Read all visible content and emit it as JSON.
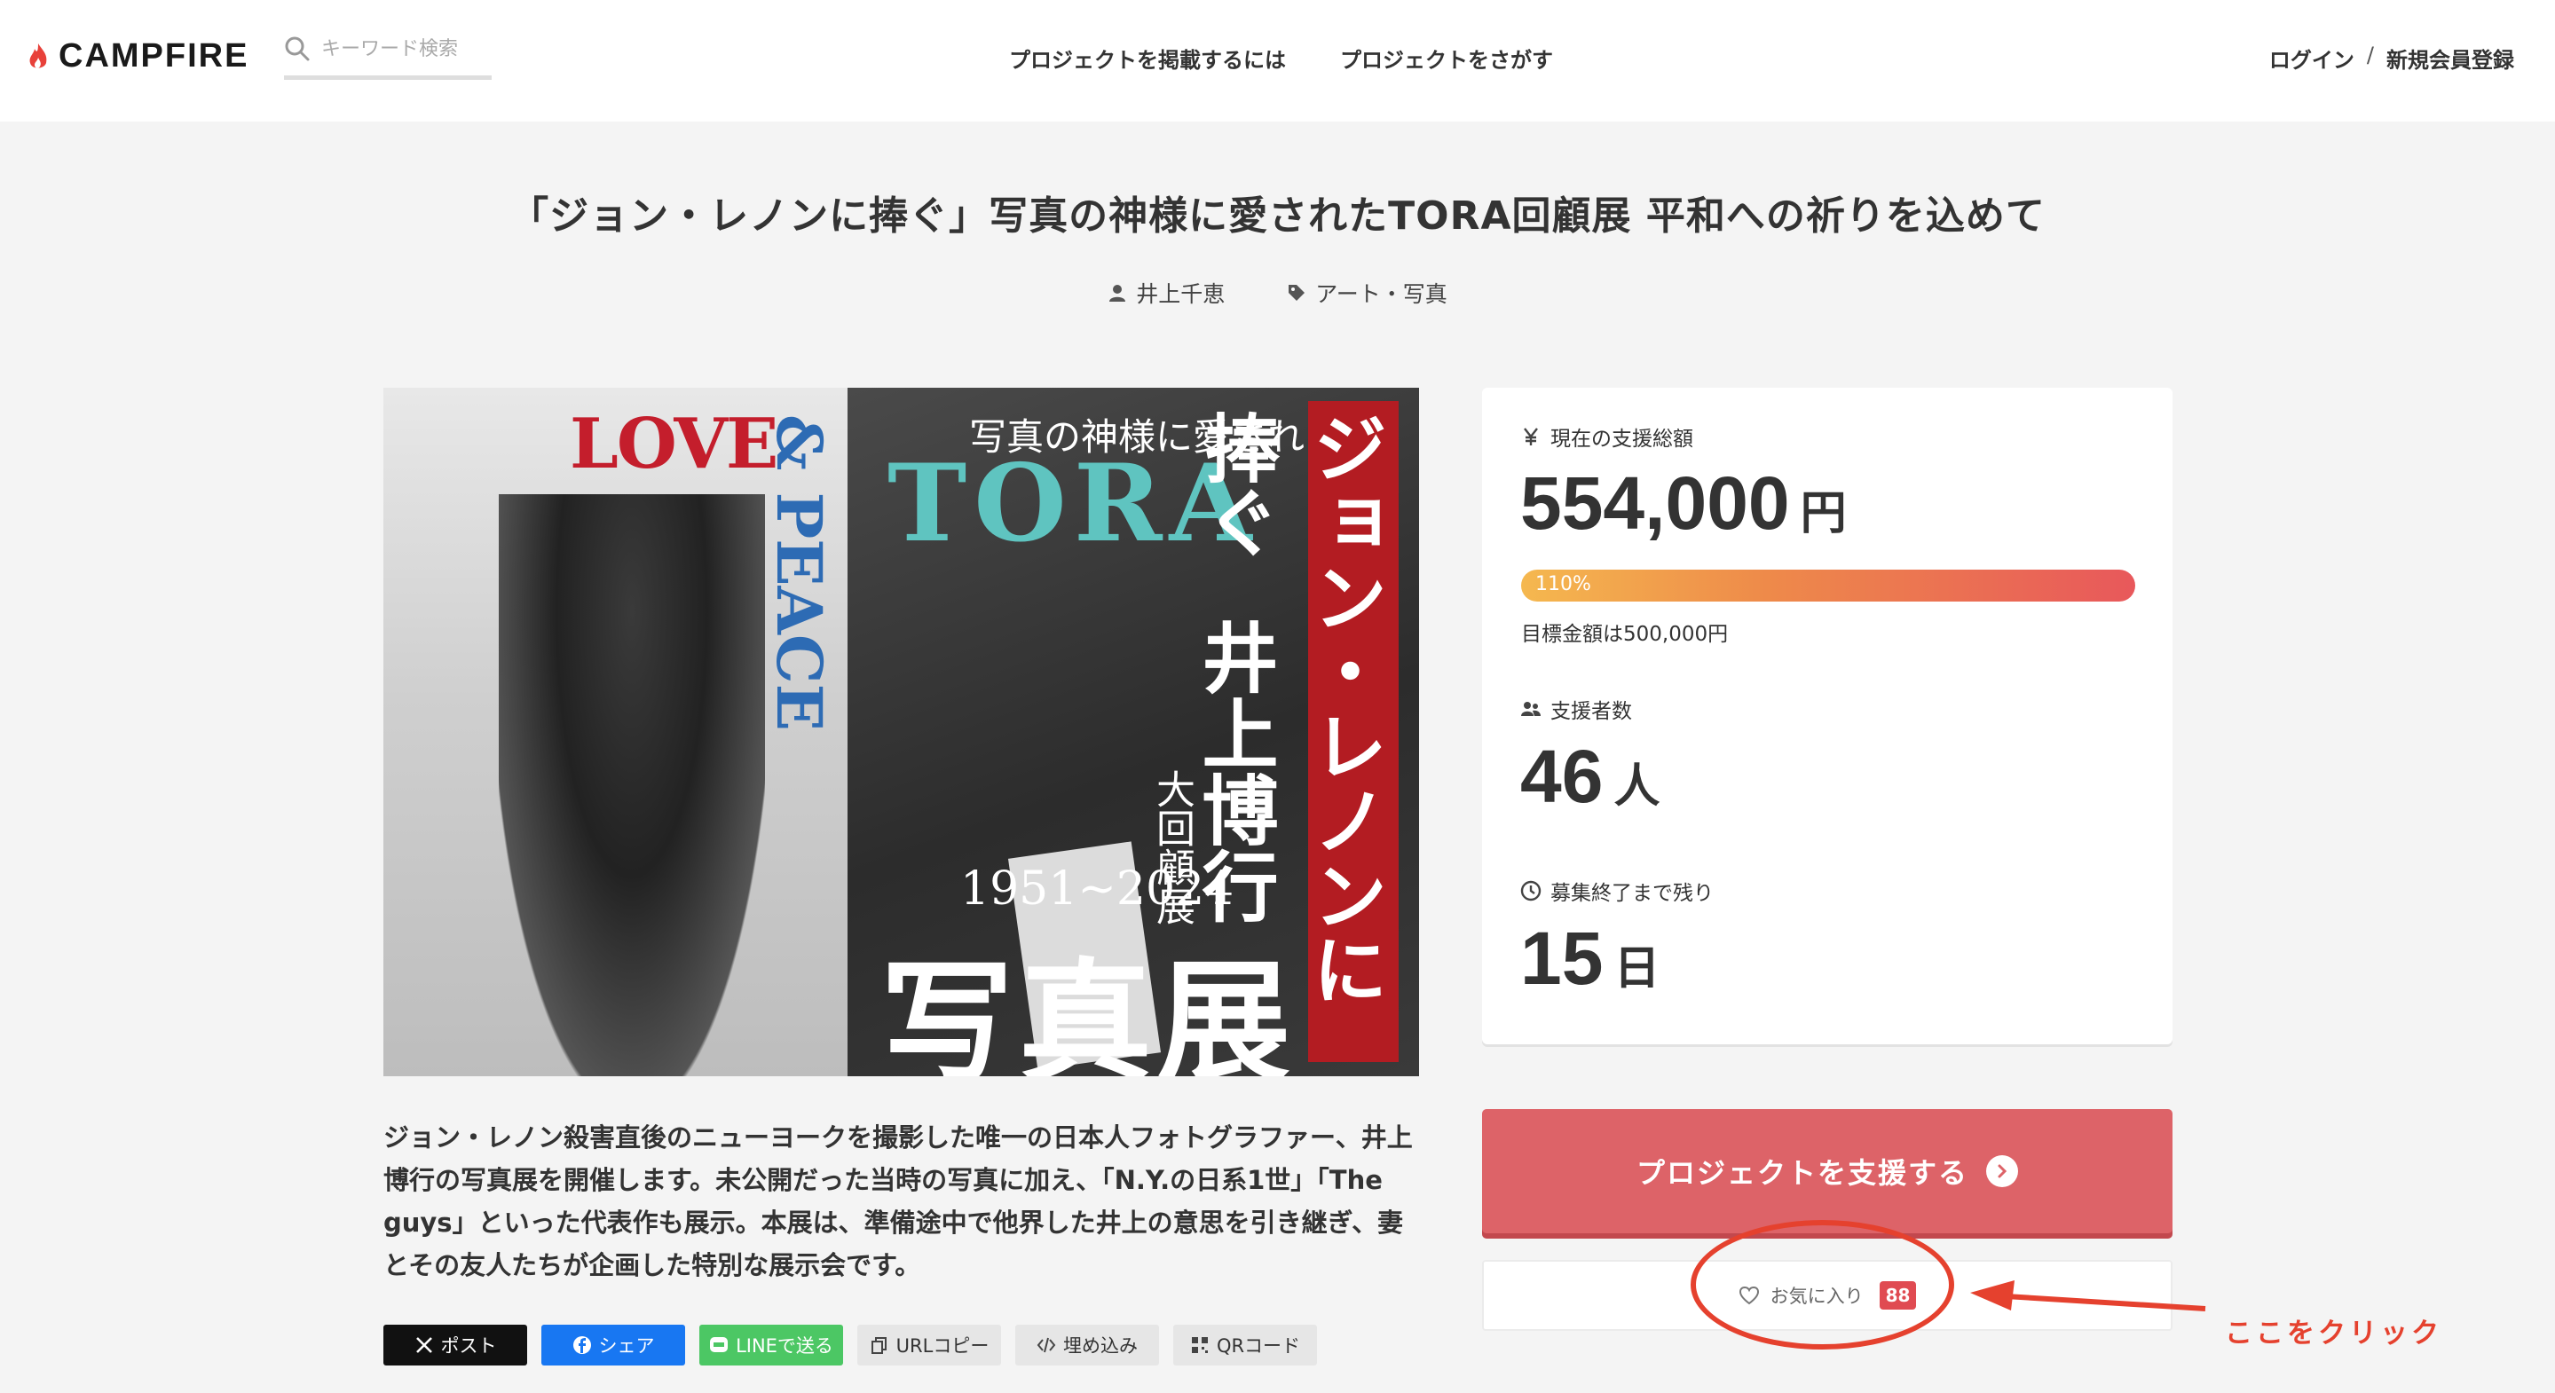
{
  "header": {
    "logo_text": "CAMPFIRE",
    "search_placeholder": "キーワード検索",
    "nav": [
      "プロジェクトを掲載するには",
      "プロジェクトをさがす"
    ],
    "login": "ログイン",
    "separator": "/",
    "signup": "新規会員登録"
  },
  "project": {
    "title": "「ジョン・レノンに捧ぐ」写真の神様に愛されたTORA回顧展 平和への祈りを込めて",
    "owner": "井上千恵",
    "category": "アート・写真",
    "description": "ジョン・レノン殺害直後のニューヨークを撮影した唯一の日本人フォトグラファー、井上博行の写真展を開催します。未公開だった当時の写真に加え、「N.Y.の日系1世」「The guys」といった代表作も展示。本展は、準備途中で他界した井上の意思を引き継ぎ、妻とその友人たちが企画した特別な展示会です。"
  },
  "hero": {
    "love": "LOVE",
    "peace": "& PEACE",
    "subtitle": "写真の神様に愛された",
    "tora": "TORA",
    "dedication": "ジョン・レノンに捧ぐ",
    "photographer": "井上博行",
    "retrospective": "大回顧展",
    "years": "1951~2024",
    "exhibition": "写真展"
  },
  "stats": {
    "total_label": "現在の支援総額",
    "total_value": "554,000",
    "total_unit": "円",
    "progress_percent": 110,
    "progress_text": "110%",
    "goal_text": "目標金額は500,000円",
    "backers_label": "支援者数",
    "backers_value": "46",
    "backers_unit": "人",
    "remaining_label": "募集終了まで残り",
    "remaining_value": "15",
    "remaining_unit": "日"
  },
  "actions": {
    "support_label": "プロジェクトを支援する",
    "favorite_label": "お気に入り",
    "favorite_count": "88"
  },
  "annotation": {
    "text": "ここをクリック",
    "color": "#e5412e"
  },
  "share": {
    "x": "ポスト",
    "facebook": "シェア",
    "line": "LINEで送る",
    "url": "URLコピー",
    "embed": "埋め込み",
    "qr": "QRコード"
  },
  "colors": {
    "brand_red": "#dd6368",
    "badge": "#e04b52",
    "facebook": "#1877f2",
    "line": "#4cc764"
  }
}
